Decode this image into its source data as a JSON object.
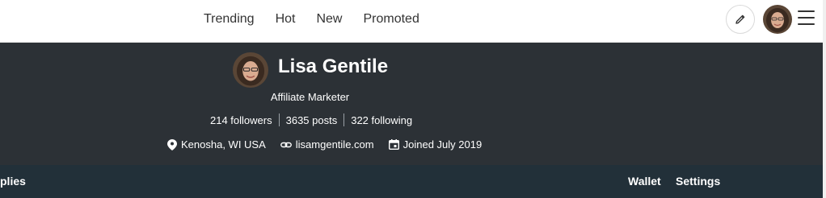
{
  "header": {
    "nav": [
      {
        "label": "Trending"
      },
      {
        "label": "Hot"
      },
      {
        "label": "New"
      },
      {
        "label": "Promoted"
      }
    ],
    "icons": {
      "compose": "pencil-icon",
      "menu": "hamburger-menu-icon"
    }
  },
  "profile": {
    "name": "Lisa Gentile",
    "title": "Affiliate Marketer",
    "stats": {
      "followers": "214 followers",
      "posts": "3635 posts",
      "following": "322 following"
    },
    "location": "Kenosha, WI USA",
    "website": "lisamgentile.com",
    "joined": "Joined July 2019"
  },
  "tabs": {
    "left_partial": "plies",
    "wallet": "Wallet",
    "settings": "Settings"
  },
  "colors": {
    "hero_bg": "#2c3136",
    "subnav_bg": "#223039",
    "nav_text": "#333333"
  }
}
